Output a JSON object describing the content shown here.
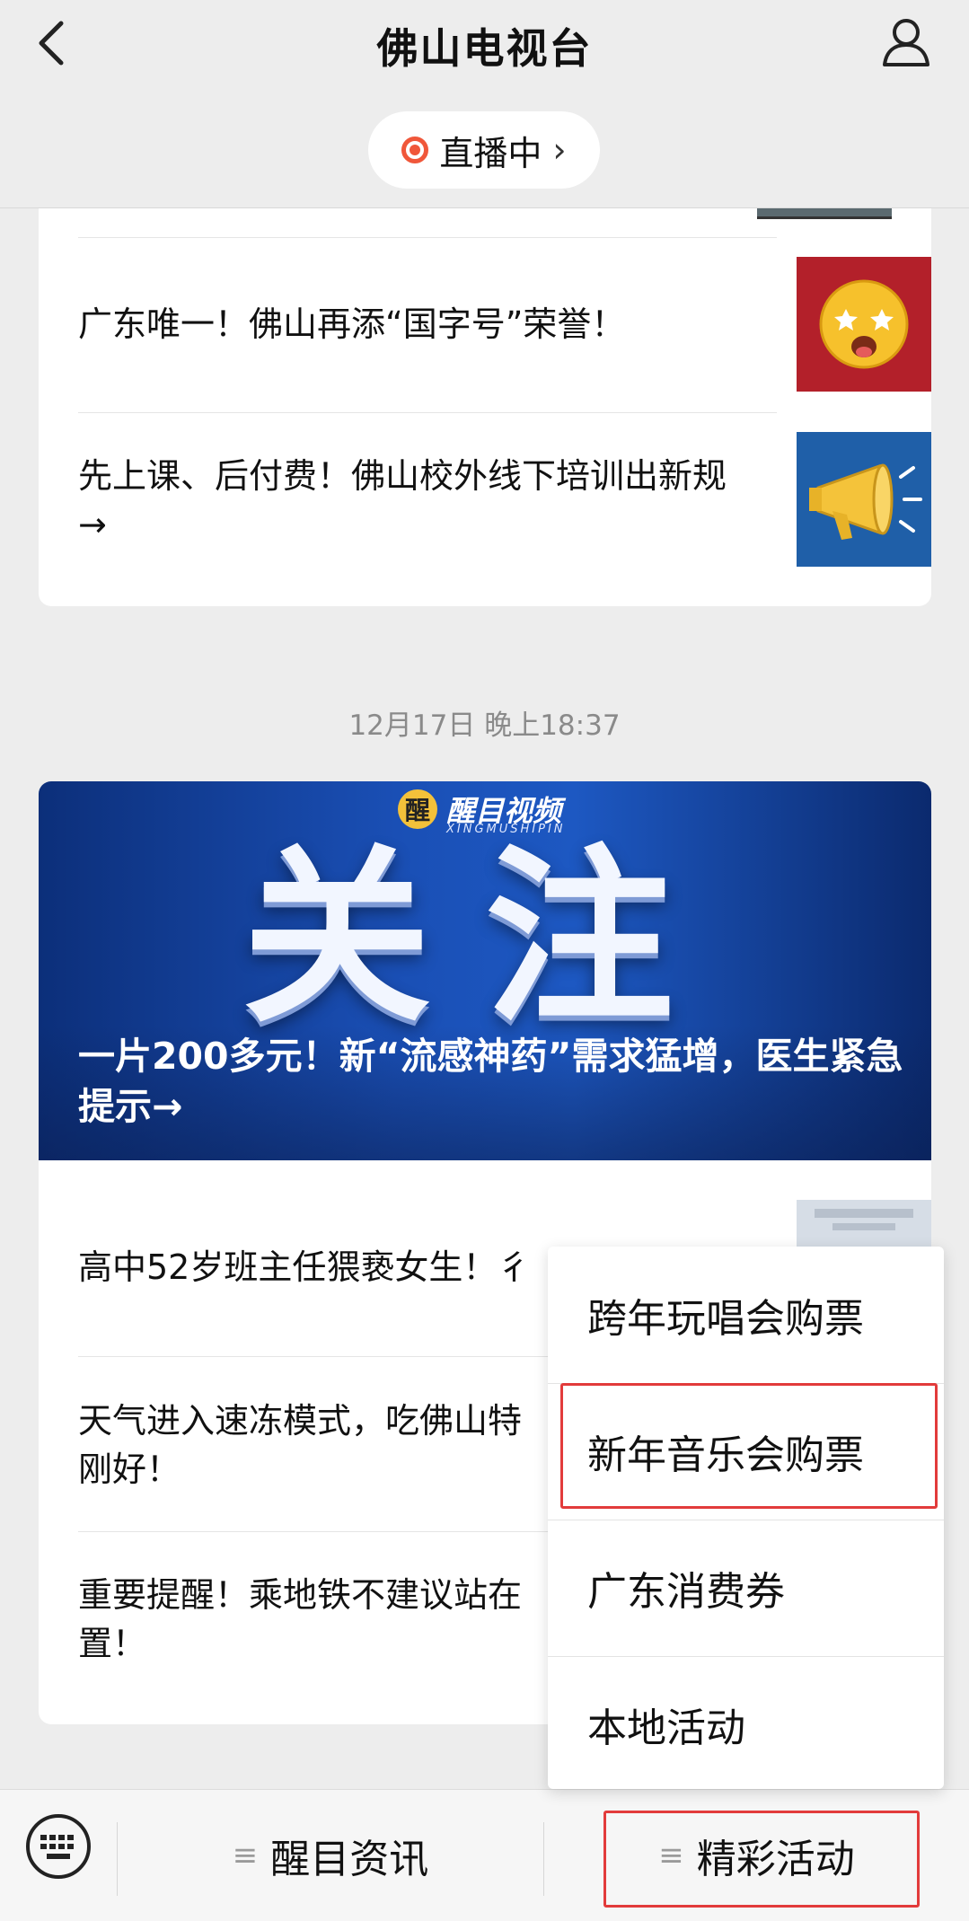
{
  "header": {
    "title": "佛山电视台",
    "back_icon": "chevron-left-icon",
    "profile_icon": "user-icon",
    "live_label": "直播中",
    "live_chevron": "›"
  },
  "feed": {
    "group1": {
      "articles": [
        {
          "title": "广东唯一！佛山再添“国字号”荣誉！",
          "thumb": "starstruck-emoji-icon"
        },
        {
          "title": "先上课、后付费！佛山校外线下培训出新规→",
          "thumb": "megaphone-icon"
        }
      ]
    },
    "timestamp": "12月17日 晚上18:37",
    "group2": {
      "banner": {
        "logo_badge": "醒",
        "logo_text": "醒目视频",
        "logo_sub": "XINGMUSHIPIN",
        "big_text": "关注",
        "caption": "一片200多元！新“流感神药”需求猛增，医生紧急提示→"
      },
      "articles": [
        {
          "title": "高中52岁班主任猥亵女生！彳"
        },
        {
          "title": "天气进入速冻模式，吃佛山特刚好！"
        },
        {
          "title": "重要提醒！乘地铁不建议站在置！"
        }
      ]
    }
  },
  "popup_menu": {
    "items": [
      "跨年玩唱会购票",
      "新年音乐会购票",
      "广东消费券",
      "本地活动"
    ],
    "highlighted_index": 1
  },
  "bottom_bar": {
    "keyboard_icon": "keyboard-icon",
    "tabs": [
      {
        "label": "醒目资讯",
        "icon": "≡"
      },
      {
        "label": "精彩活动",
        "icon": "≡"
      }
    ]
  },
  "colors": {
    "background": "#ededed",
    "live_dot": "#f0573a",
    "highlight": "#e23b3b",
    "banner_blue": "#1a4fb5"
  }
}
